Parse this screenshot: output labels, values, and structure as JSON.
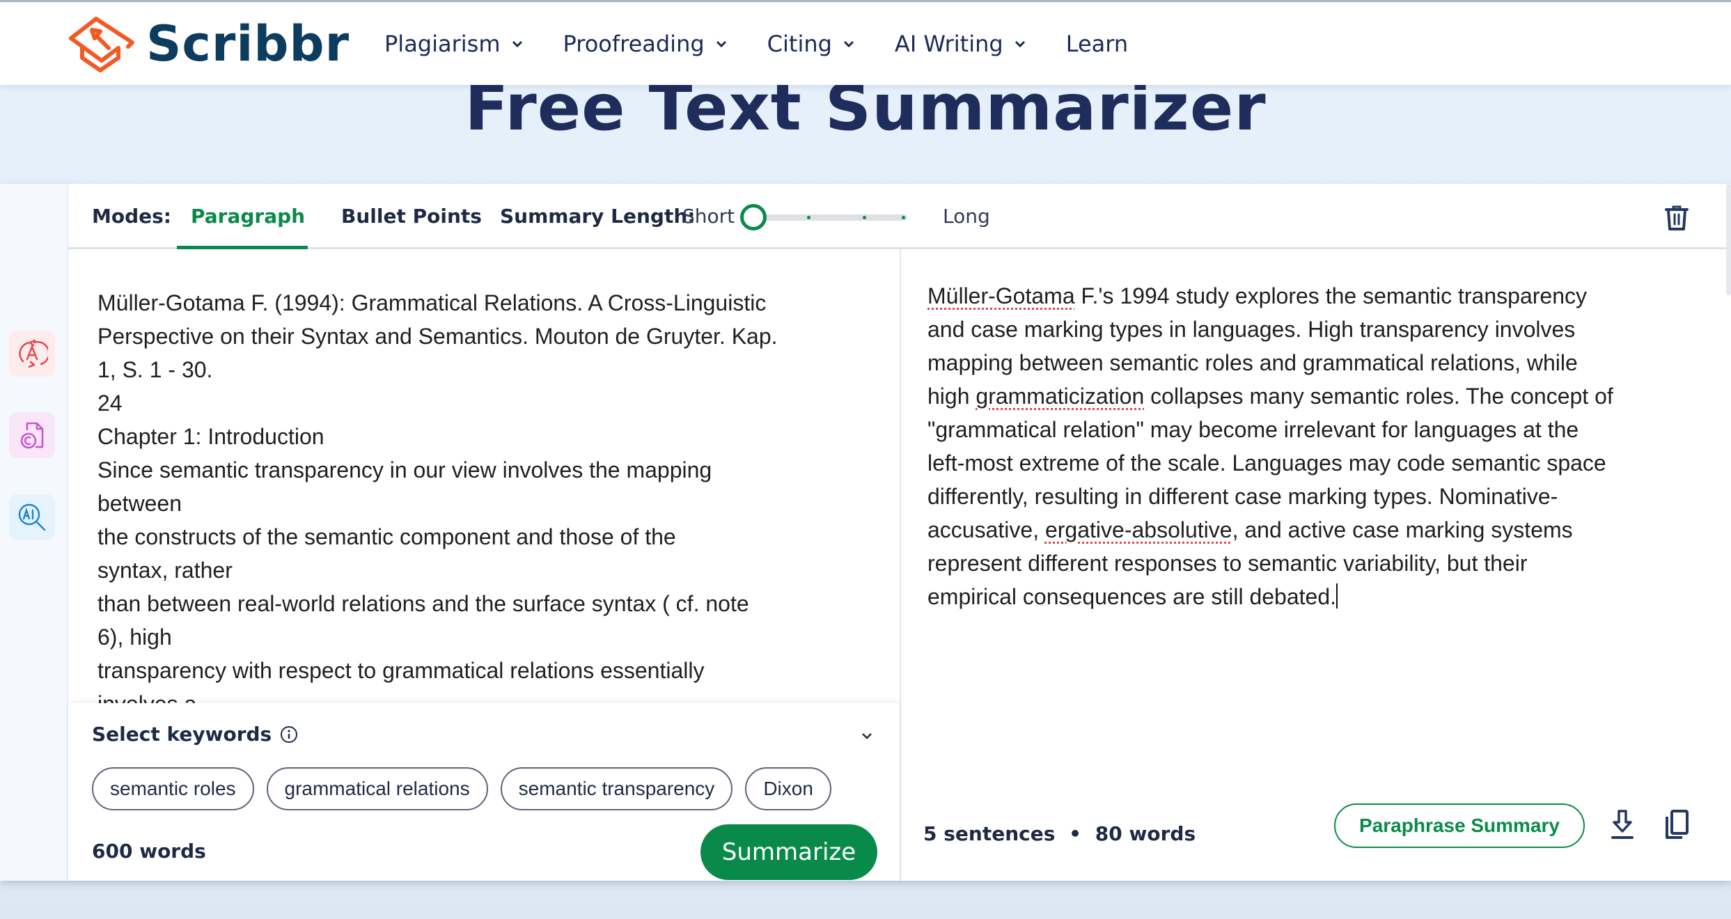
{
  "header": {
    "logo_text": "Scribbr",
    "nav": [
      {
        "label": "Plagiarism",
        "has_dropdown": true
      },
      {
        "label": "Proofreading",
        "has_dropdown": true
      },
      {
        "label": "Citing",
        "has_dropdown": true
      },
      {
        "label": "AI Writing",
        "has_dropdown": true
      },
      {
        "label": "Learn",
        "has_dropdown": false
      }
    ]
  },
  "page_title": "Free Text Summarizer",
  "sidebar": {
    "tools": [
      {
        "icon": "paraphrase-icon",
        "color": "#e5474c",
        "bg": "#fdecec"
      },
      {
        "icon": "plagiarism-checker-icon",
        "color": "#c557c9",
        "bg": "#f9e6f8"
      },
      {
        "icon": "ai-detector-icon",
        "color": "#1b84d8",
        "bg": "#e6f3fc"
      }
    ]
  },
  "toolbar": {
    "modes_label": "Modes:",
    "modes": [
      {
        "label": "Paragraph",
        "active": true
      },
      {
        "label": "Bullet Points",
        "active": false
      }
    ],
    "length_label": "Summary Length:",
    "length_min_label": "Short",
    "length_max_label": "Long",
    "length_value": 0,
    "length_steps": 4
  },
  "input": {
    "lines": [
      "Müller-Gotama F. (1994): Grammatical Relations. A Cross-Linguistic",
      "Perspective on their Syntax and Semantics. Mouton de Gruyter. Kap.",
      "1, S. 1 - 30.",
      "24",
      "Chapter  1: Introduction",
      "Since  semantic  transparency  in  our  view  involves the  mapping",
      "between",
      "the  constructs  of  the  semantic  component  and  those  of  the",
      "syntax,  rather",
      "than  between real-world  relations  and the  surface syntax ( cf.  note",
      "6),  high",
      "transparency  with  respect  to  grammatical  relations  essentially",
      "involves  a"
    ],
    "word_count": "600 words"
  },
  "keywords": {
    "title": "Select keywords",
    "chips": [
      "semantic roles",
      "grammatical relations",
      "semantic transparency",
      "Dixon"
    ]
  },
  "summarize_label": "Summarize",
  "output": {
    "lines": [
      [
        {
          "t": "Müller-Gotama",
          "spell": true
        },
        {
          "t": " F.'s 1994 study explores the semantic transparency"
        }
      ],
      [
        {
          "t": "and case marking types in languages. High transparency involves"
        }
      ],
      [
        {
          "t": "mapping between semantic roles and grammatical relations, while"
        }
      ],
      [
        {
          "t": "high "
        },
        {
          "t": "grammaticization",
          "spell": true
        },
        {
          "t": " collapses many semantic roles. The concept of"
        }
      ],
      [
        {
          "t": "\"grammatical relation\" may become irrelevant for languages at the"
        }
      ],
      [
        {
          "t": "left-most extreme of the scale. Languages may code semantic space"
        }
      ],
      [
        {
          "t": "differently, resulting in different case marking types. Nominative-"
        }
      ],
      [
        {
          "t": "accusative, "
        },
        {
          "t": "ergative-absolutive",
          "spell": true
        },
        {
          "t": ", and active case marking systems"
        }
      ],
      [
        {
          "t": "represent different responses to semantic variability, but their"
        }
      ],
      [
        {
          "t": "empirical consequences are still debated."
        }
      ]
    ],
    "sentences": "5 sentences",
    "separator": "•",
    "words": "80 words",
    "paraphrase_label": "Paraphrase Summary"
  },
  "colors": {
    "accent": "#0a8a4a",
    "title": "#1f2d5c",
    "logo_orange": "#f15a24",
    "logo_navy": "#0d3c5e"
  }
}
